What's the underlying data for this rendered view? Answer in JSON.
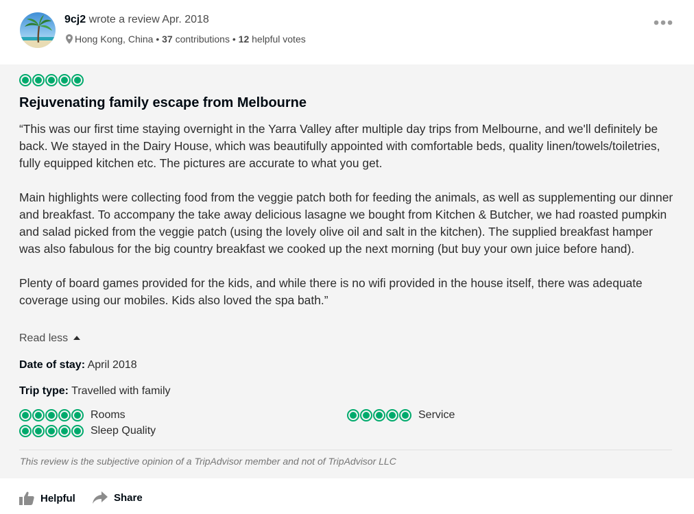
{
  "review": {
    "author": "9cj2",
    "wrote_text": "wrote a review Apr. 2018",
    "location": "Hong Kong, China",
    "separator": "•",
    "contributions_count": "37",
    "contributions_label": "contributions",
    "helpful_votes_count": "12",
    "helpful_votes_label": "helpful votes",
    "rating": 5,
    "title": "Rejuvenating family escape from Melbourne",
    "paragraphs": [
      "“This was our first time staying overnight in the Yarra Valley after multiple day trips from Melbourne, and we'll definitely be back. We stayed in the Dairy House, which was beautifully appointed with comfortable beds, quality linen/towels/toiletries, fully equipped kitchen etc. The pictures are accurate to what you get.",
      "Main highlights were collecting food from the veggie patch both for feeding the animals, as well as supplementing our dinner and breakfast. To accompany the take away delicious lasagne we bought from Kitchen & Butcher, we had roasted pumpkin and salad picked from the veggie patch (using the lovely olive oil and salt in the kitchen). The supplied breakfast hamper was also fabulous for the big country breakfast we cooked up the next morning (but buy your own juice before hand).",
      "Plenty of board games provided for the kids, and while there is no wifi provided in the house itself, there was adequate coverage using our mobiles. Kids also loved the spa bath.”"
    ],
    "read_less_label": "Read less",
    "date_of_stay_label": "Date of stay:",
    "date_of_stay_value": "April 2018",
    "trip_type_label": "Trip type:",
    "trip_type_value": "Travelled with family",
    "sub_ratings": [
      {
        "label": "Rooms",
        "rating": 5
      },
      {
        "label": "Sleep Quality",
        "rating": 5
      },
      {
        "label": "Service",
        "rating": 5
      }
    ],
    "disclaimer": "This review is the subjective opinion of a TripAdvisor member and not of TripAdvisor LLC"
  },
  "actions": {
    "helpful_label": "Helpful",
    "share_label": "Share"
  },
  "icons": {
    "location": "map-pin-icon",
    "more": "more-options-icon",
    "helpful": "thumbs-up-icon",
    "share": "share-arrow-icon",
    "collapse": "caret-up-icon"
  },
  "colors": {
    "rating_bubble": "#00aa6c",
    "body_background": "#f4f4f4",
    "icon_gray": "#8c8c8c"
  }
}
